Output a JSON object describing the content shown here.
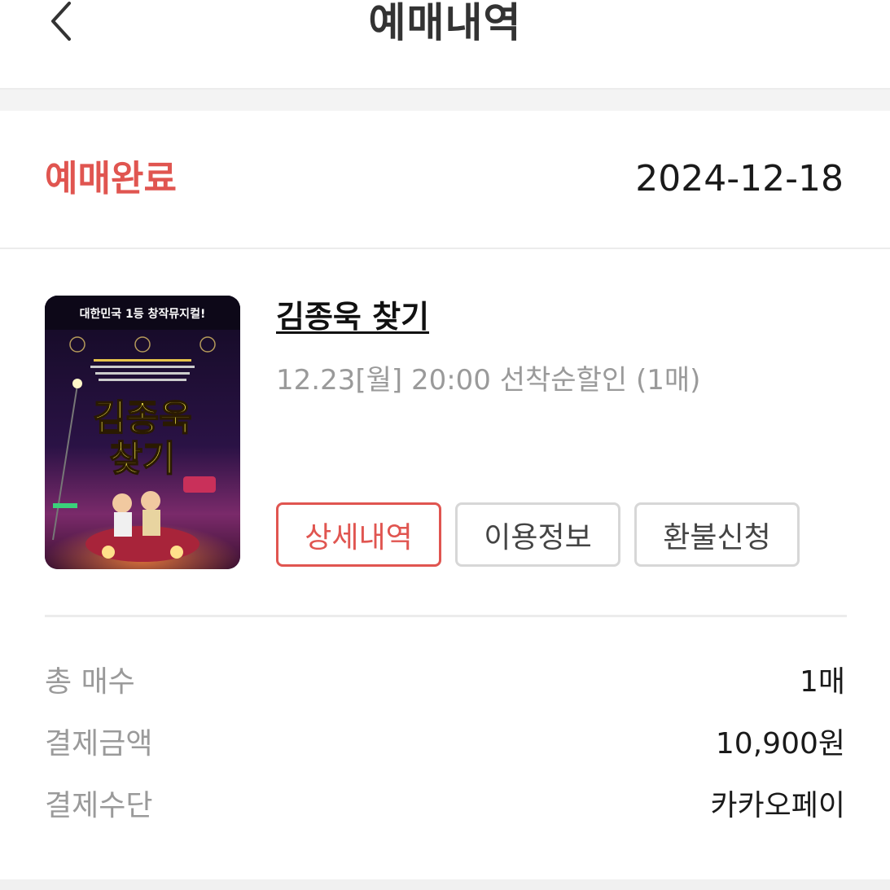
{
  "header": {
    "title": "예매내역",
    "back_icon": "chevron-left-icon"
  },
  "booking": {
    "status": "예매완료",
    "date": "2024-12-18",
    "status_color": "#e05550"
  },
  "show": {
    "title": "김종욱 찾기",
    "subtitle": "12.23[월] 20:00 선착순할인 (1매)",
    "poster": {
      "top_banner": "대한민국 1등 창작뮤지컬!",
      "title_line1": "김종욱",
      "title_line2": "찾기"
    }
  },
  "actions": {
    "details_label": "상세내역",
    "usage_label": "이용정보",
    "refund_label": "환불신청"
  },
  "summary": {
    "rows": [
      {
        "label": "총 매수",
        "value": "1매"
      },
      {
        "label": "결제금액",
        "value": "10,900원"
      },
      {
        "label": "결제수단",
        "value": "카카오페이"
      }
    ]
  },
  "colors": {
    "accent": "#e05550",
    "muted_text": "#9a9a9a",
    "border": "#d7d7d7"
  }
}
